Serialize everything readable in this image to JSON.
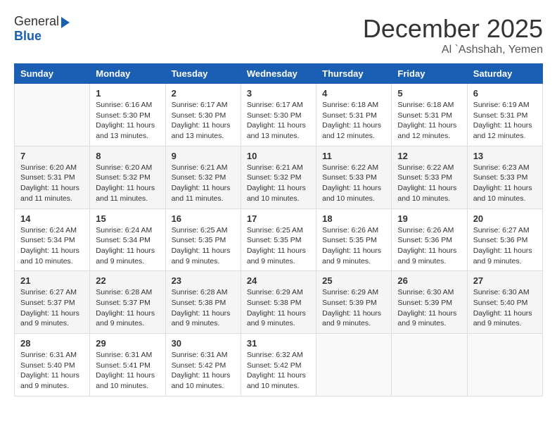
{
  "header": {
    "logo_general": "General",
    "logo_blue": "Blue",
    "month_title": "December 2025",
    "location": "Al `Ashshah, Yemen"
  },
  "calendar": {
    "days_of_week": [
      "Sunday",
      "Monday",
      "Tuesday",
      "Wednesday",
      "Thursday",
      "Friday",
      "Saturday"
    ],
    "weeks": [
      [
        {
          "day": "",
          "content": ""
        },
        {
          "day": "1",
          "content": "Sunrise: 6:16 AM\nSunset: 5:30 PM\nDaylight: 11 hours\nand 13 minutes."
        },
        {
          "day": "2",
          "content": "Sunrise: 6:17 AM\nSunset: 5:30 PM\nDaylight: 11 hours\nand 13 minutes."
        },
        {
          "day": "3",
          "content": "Sunrise: 6:17 AM\nSunset: 5:30 PM\nDaylight: 11 hours\nand 13 minutes."
        },
        {
          "day": "4",
          "content": "Sunrise: 6:18 AM\nSunset: 5:31 PM\nDaylight: 11 hours\nand 12 minutes."
        },
        {
          "day": "5",
          "content": "Sunrise: 6:18 AM\nSunset: 5:31 PM\nDaylight: 11 hours\nand 12 minutes."
        },
        {
          "day": "6",
          "content": "Sunrise: 6:19 AM\nSunset: 5:31 PM\nDaylight: 11 hours\nand 12 minutes."
        }
      ],
      [
        {
          "day": "7",
          "content": "Sunrise: 6:20 AM\nSunset: 5:31 PM\nDaylight: 11 hours\nand 11 minutes."
        },
        {
          "day": "8",
          "content": "Sunrise: 6:20 AM\nSunset: 5:32 PM\nDaylight: 11 hours\nand 11 minutes."
        },
        {
          "day": "9",
          "content": "Sunrise: 6:21 AM\nSunset: 5:32 PM\nDaylight: 11 hours\nand 11 minutes."
        },
        {
          "day": "10",
          "content": "Sunrise: 6:21 AM\nSunset: 5:32 PM\nDaylight: 11 hours\nand 10 minutes."
        },
        {
          "day": "11",
          "content": "Sunrise: 6:22 AM\nSunset: 5:33 PM\nDaylight: 11 hours\nand 10 minutes."
        },
        {
          "day": "12",
          "content": "Sunrise: 6:22 AM\nSunset: 5:33 PM\nDaylight: 11 hours\nand 10 minutes."
        },
        {
          "day": "13",
          "content": "Sunrise: 6:23 AM\nSunset: 5:33 PM\nDaylight: 11 hours\nand 10 minutes."
        }
      ],
      [
        {
          "day": "14",
          "content": "Sunrise: 6:24 AM\nSunset: 5:34 PM\nDaylight: 11 hours\nand 10 minutes."
        },
        {
          "day": "15",
          "content": "Sunrise: 6:24 AM\nSunset: 5:34 PM\nDaylight: 11 hours\nand 9 minutes."
        },
        {
          "day": "16",
          "content": "Sunrise: 6:25 AM\nSunset: 5:35 PM\nDaylight: 11 hours\nand 9 minutes."
        },
        {
          "day": "17",
          "content": "Sunrise: 6:25 AM\nSunset: 5:35 PM\nDaylight: 11 hours\nand 9 minutes."
        },
        {
          "day": "18",
          "content": "Sunrise: 6:26 AM\nSunset: 5:35 PM\nDaylight: 11 hours\nand 9 minutes."
        },
        {
          "day": "19",
          "content": "Sunrise: 6:26 AM\nSunset: 5:36 PM\nDaylight: 11 hours\nand 9 minutes."
        },
        {
          "day": "20",
          "content": "Sunrise: 6:27 AM\nSunset: 5:36 PM\nDaylight: 11 hours\nand 9 minutes."
        }
      ],
      [
        {
          "day": "21",
          "content": "Sunrise: 6:27 AM\nSunset: 5:37 PM\nDaylight: 11 hours\nand 9 minutes."
        },
        {
          "day": "22",
          "content": "Sunrise: 6:28 AM\nSunset: 5:37 PM\nDaylight: 11 hours\nand 9 minutes."
        },
        {
          "day": "23",
          "content": "Sunrise: 6:28 AM\nSunset: 5:38 PM\nDaylight: 11 hours\nand 9 minutes."
        },
        {
          "day": "24",
          "content": "Sunrise: 6:29 AM\nSunset: 5:38 PM\nDaylight: 11 hours\nand 9 minutes."
        },
        {
          "day": "25",
          "content": "Sunrise: 6:29 AM\nSunset: 5:39 PM\nDaylight: 11 hours\nand 9 minutes."
        },
        {
          "day": "26",
          "content": "Sunrise: 6:30 AM\nSunset: 5:39 PM\nDaylight: 11 hours\nand 9 minutes."
        },
        {
          "day": "27",
          "content": "Sunrise: 6:30 AM\nSunset: 5:40 PM\nDaylight: 11 hours\nand 9 minutes."
        }
      ],
      [
        {
          "day": "28",
          "content": "Sunrise: 6:31 AM\nSunset: 5:40 PM\nDaylight: 11 hours\nand 9 minutes."
        },
        {
          "day": "29",
          "content": "Sunrise: 6:31 AM\nSunset: 5:41 PM\nDaylight: 11 hours\nand 10 minutes."
        },
        {
          "day": "30",
          "content": "Sunrise: 6:31 AM\nSunset: 5:42 PM\nDaylight: 11 hours\nand 10 minutes."
        },
        {
          "day": "31",
          "content": "Sunrise: 6:32 AM\nSunset: 5:42 PM\nDaylight: 11 hours\nand 10 minutes."
        },
        {
          "day": "",
          "content": ""
        },
        {
          "day": "",
          "content": ""
        },
        {
          "day": "",
          "content": ""
        }
      ]
    ]
  }
}
